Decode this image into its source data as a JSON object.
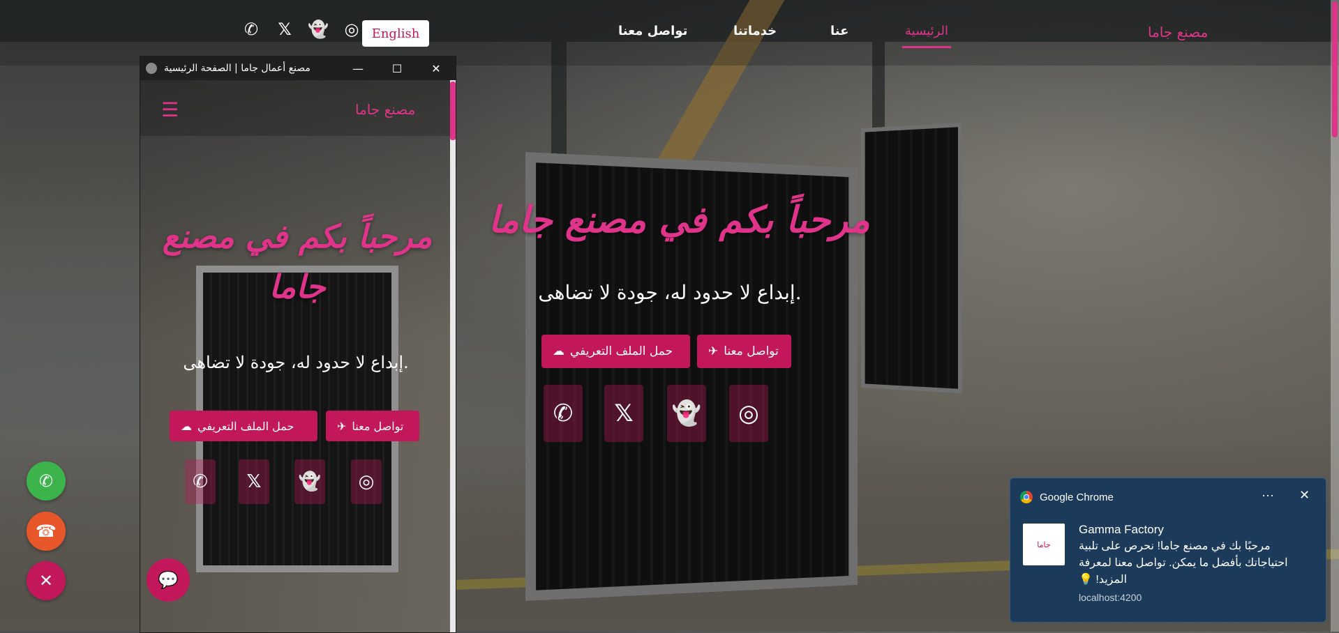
{
  "topnav": {
    "language_button": "English",
    "links": [
      "تواصل معنا",
      "خدماتنا",
      "عنا",
      "الرئيسية"
    ],
    "active_link": "الرئيسية",
    "brand": "مصنع جاما",
    "social_icons": [
      "whatsapp-icon",
      "x-icon",
      "snapchat-icon",
      "instagram-icon"
    ]
  },
  "hero": {
    "title": "مرحباً بكم في مصنع جاما",
    "subtitle": "إبداع لا حدود له، جودة لا تضاهى.",
    "download_button": "حمل الملف التعريفي",
    "contact_button": "تواصل معنا"
  },
  "popup_window": {
    "title": "مصنع أعمال جاما | الصفحة الرئيسية",
    "brand": "مصنع جاما",
    "hero_title_line1": "مرحباً بكم في مصنع",
    "hero_title_line2": "جاما",
    "subtitle": "إبداع لا حدود له، جودة لا تضاهى.",
    "download_button": "حمل الملف التعريفي",
    "contact_button": "تواصل معنا"
  },
  "fabs": [
    {
      "name": "whatsapp",
      "color": "#3cb44b"
    },
    {
      "name": "phone",
      "color": "#e8572a"
    },
    {
      "name": "close",
      "color": "#c2185b"
    }
  ],
  "notification": {
    "app": "Google Chrome",
    "sender": "Gamma Factory",
    "message": "مرحبًا بك في مصنع جاما! نحرص على تلبية احتياجاتك بأفضل ما يمكن. تواصل معنا لمعرفة المزيد! 💡",
    "source": "localhost:4200",
    "thumb_text": "جاما"
  },
  "colors": {
    "accent": "#e0348b",
    "button": "#c2185b",
    "notification_bg": "#1c3a5a"
  }
}
